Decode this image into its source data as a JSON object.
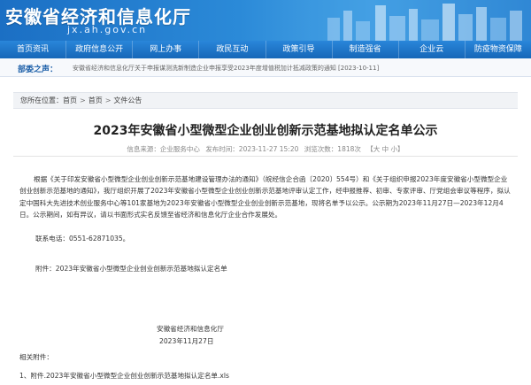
{
  "site": {
    "title": "安徽省经济和信息化厅",
    "domain": "jx.ah.gov.cn"
  },
  "nav": {
    "items": [
      "首页资讯",
      "政府信息公开",
      "网上办事",
      "政民互动",
      "政策引导",
      "制造强省",
      "企业云",
      "防疫物资保障"
    ]
  },
  "ticker": {
    "label": "部委之声：",
    "text": "安徽省经济和信息化厅关于申报谋测洗新制造企业申报享受2023年度增值税加计抵减政策的通知 [2023-10-11]"
  },
  "breadcrumb": {
    "prefix": "您所在位置：",
    "items": [
      "首页",
      "首页",
      "文件公告"
    ],
    "separator": ">"
  },
  "article": {
    "title": "2023年安徽省小型微型企业创业创新示范基地拟认定名单公示",
    "meta": {
      "source": "信息来源：企业服务中心",
      "date": "发布时间：2023-11-27 15:20",
      "views": "浏览次数：1818次",
      "font_size": "【大 中 小】"
    },
    "body": "根据《关于印发安徽省小型微型企业创业创新示范基地建设管理办法的通知》（皖经信企合函〔2020〕554号）和《关于组织申报2023年度安徽省小型微型企业创业创新示范基地的通知》，我厅组织开展了2023年安徽省小型微型企业创业创新示范基地评审认定工作，经申报推荐、初审、专家评审、厅党组会审议等程序，拟认定中国科大先进技术创业服务中心等101家基地为2023年安徽省小型微型企业创业创新示范基地，现将名单予以公示。公示期为2023年11月27日—2023年12月4日。公示期间，如有异议，请以书面形式实名反馈至省经济和信息化厅企业合作发展处。",
    "contact": "联系电话：0551-62871035。",
    "attachment": "附件：2023年安徽省小型微型企业创业创新示范基地拟认定名单",
    "signature": "安徽省经济和信息化厅",
    "sign_date": "2023年11月27日",
    "related_label": "相关附件：",
    "related_file": "1、附件.2023年安徽省小型微型企业创业创新示范基地拟认定名单.xls"
  }
}
